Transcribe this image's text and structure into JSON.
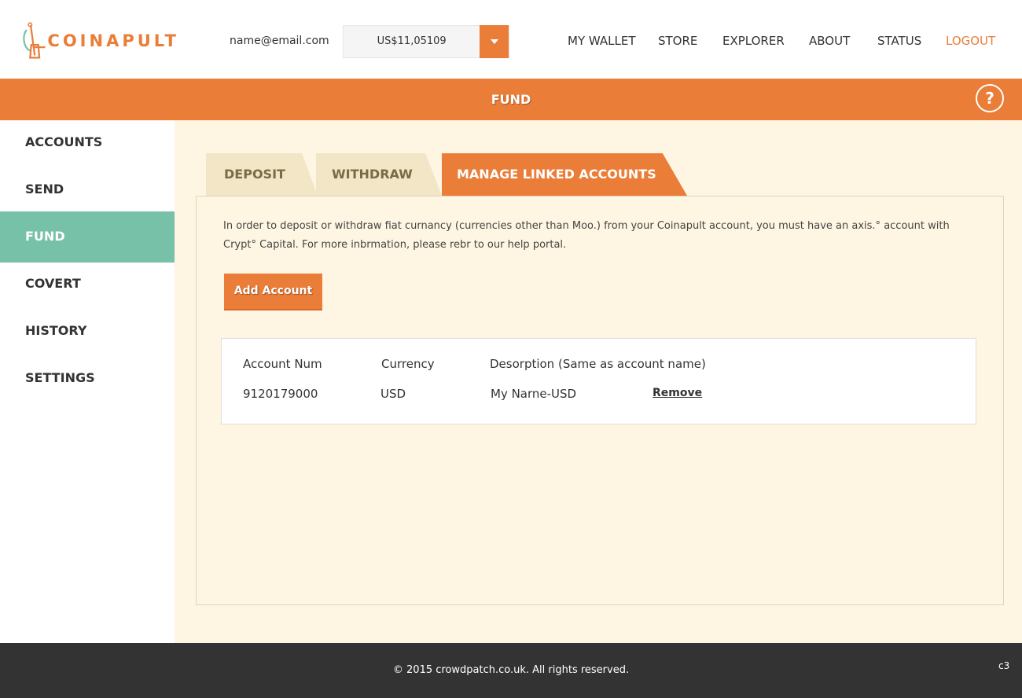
{
  "brand": {
    "name": "COINAPULT",
    "accent": "#ea7d37",
    "active_nav_color": "#78c1a9"
  },
  "header": {
    "email": "name@email.com",
    "balance": "US$11,05109",
    "balance_dropdown_icon": "caret-down-icon",
    "nav": [
      "MY WALLET",
      "STORE",
      "EXPLORER",
      "ABOUT",
      "STATUS",
      "LOGOUT"
    ]
  },
  "titlebar": {
    "title": "FUND",
    "help": "?"
  },
  "sidebar": {
    "items": [
      "ACCOUNTS",
      "SEND",
      "FUND",
      "COVERT",
      "HISTORY",
      "SETTINGS"
    ],
    "active": "FUND"
  },
  "tabs": {
    "items": [
      "DEPOSIT",
      "WITHDRAW",
      "MANAGE LINKED ACCOUNTS"
    ],
    "active": "MANAGE LINKED ACCOUNTS"
  },
  "content": {
    "info": "In order to deposit or withdraw fiat curnancy (currencies other than Moo.) from your Coinapult account, you must have an axis.° account with Crypt° Capital. For more inbrmation, please rebr to our help portal.",
    "add_button": "Add Account",
    "table": {
      "headers": [
        "Account Num",
        "Currency",
        "Desorption (Same as account name)"
      ],
      "rows": [
        {
          "account": "9120179000",
          "currency": "USD",
          "description": "My Narne-USD",
          "action": "Remove"
        }
      ]
    }
  },
  "footer": {
    "copyright": "© 2015 crowdpatch.co.uk. All rights reserved.",
    "code": "c3"
  }
}
